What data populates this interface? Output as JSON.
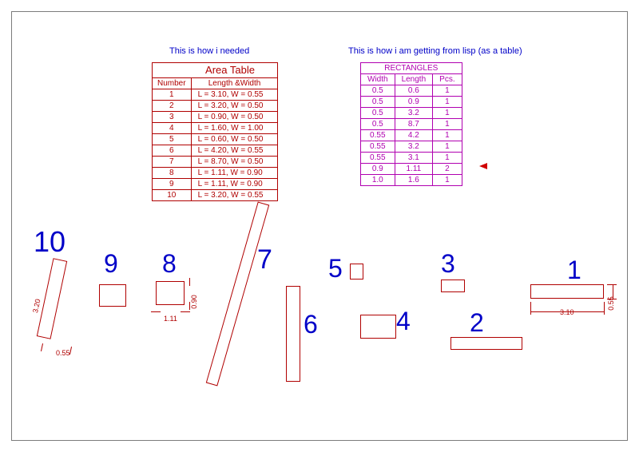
{
  "captions": {
    "left": "This is how i needed",
    "right": "This is how i am getting from lisp (as a table)"
  },
  "area_table": {
    "title": "Area Table",
    "headers": [
      "Number",
      "Length   &Width"
    ],
    "rows": [
      {
        "n": "1",
        "lw": "L = 3.10,  W = 0.55"
      },
      {
        "n": "2",
        "lw": "L = 3.20,  W = 0.50"
      },
      {
        "n": "3",
        "lw": "L = 0.90,  W = 0.50"
      },
      {
        "n": "4",
        "lw": "L = 1.60,  W = 1.00"
      },
      {
        "n": "5",
        "lw": "L = 0.60,  W = 0.50"
      },
      {
        "n": "6",
        "lw": "L = 4.20,  W = 0.55"
      },
      {
        "n": "7",
        "lw": "L = 8.70,  W = 0.50"
      },
      {
        "n": "8",
        "lw": "L = 1.11,  W = 0.90"
      },
      {
        "n": "9",
        "lw": "L = 1.11,  W = 0.90"
      },
      {
        "n": "10",
        "lw": "L = 3.20,  W = 0.55"
      }
    ]
  },
  "rect_table": {
    "title": "RECTANGLES",
    "headers": [
      "Width",
      "Length",
      "Pcs."
    ],
    "rows": [
      {
        "w": "0.5",
        "l": "0.6",
        "p": "1"
      },
      {
        "w": "0.5",
        "l": "0.9",
        "p": "1"
      },
      {
        "w": "0.5",
        "l": "3.2",
        "p": "1"
      },
      {
        "w": "0.5",
        "l": "8.7",
        "p": "1"
      },
      {
        "w": "0.55",
        "l": "4.2",
        "p": "1"
      },
      {
        "w": "0.55",
        "l": "3.2",
        "p": "1"
      },
      {
        "w": "0.55",
        "l": "3.1",
        "p": "1"
      },
      {
        "w": "0.9",
        "l": "1.11",
        "p": "2"
      },
      {
        "w": "1.0",
        "l": "1.6",
        "p": "1"
      }
    ],
    "arrow_row_index": 7
  },
  "shapes": {
    "numbers": {
      "1": "1",
      "2": "2",
      "3": "3",
      "4": "4",
      "5": "5",
      "6": "6",
      "7": "7",
      "8": "8",
      "9": "9",
      "10": "10"
    },
    "dims": {
      "d310": "3.10",
      "d055a": "0.55",
      "d090": "0.90",
      "d111": "1.11",
      "d320": "3.20",
      "d055b": "0.55"
    }
  }
}
